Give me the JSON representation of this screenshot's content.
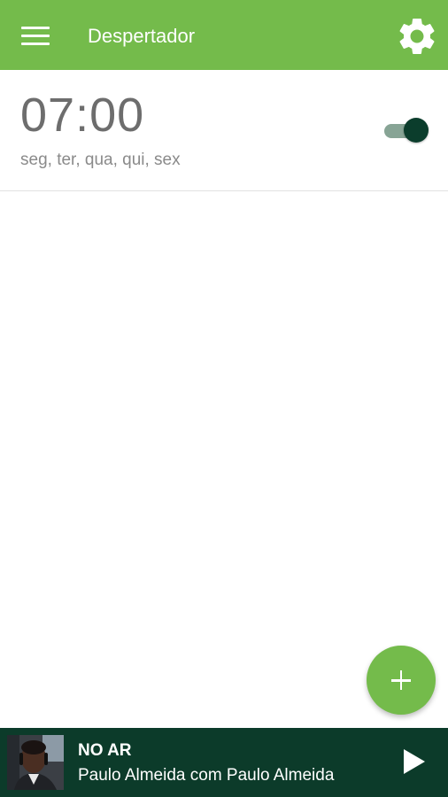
{
  "app": {
    "title": "Despertador",
    "accent_color": "#74bb4b"
  },
  "header": {
    "menu_icon": "hamburger-menu-icon",
    "settings_icon": "gear-icon"
  },
  "alarms": [
    {
      "time": "07:00",
      "days": "seg, ter, qua, qui, sex",
      "enabled": true
    }
  ],
  "fab": {
    "icon": "plus-icon"
  },
  "player": {
    "status": "NO AR",
    "program": "Paulo Almeida com Paulo Almeida",
    "play_icon": "play-icon",
    "background_color": "#0c3b2a"
  }
}
